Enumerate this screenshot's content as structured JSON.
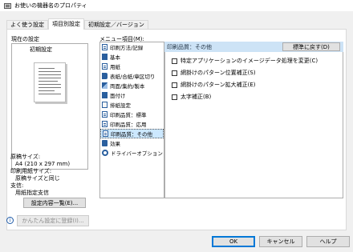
{
  "window": {
    "title": "お使いの機器名のプロパティ"
  },
  "tabs": [
    {
      "label": "よく使う設定"
    },
    {
      "label": "項目別設定"
    },
    {
      "label": "初期設定／バージョン"
    }
  ],
  "preview": {
    "heading": "現在の設定",
    "subheading": "初期設定",
    "info_lines": [
      "原稿サイズ:",
      "A4 (210 x 297 mm)",
      "印刷用紙サイズ:",
      "原稿サイズと同じ",
      "支信:",
      "用紙指定支信"
    ],
    "list_button": "設定内容一覧(E)...",
    "register_button": "かんたん設定に登録(I)..."
  },
  "menu": {
    "label": "メニュー項目(M):",
    "items": [
      {
        "label": "印刷方法/記録",
        "icon": "print-method-icon"
      },
      {
        "label": "基本",
        "icon": "basic-icon"
      },
      {
        "label": "用紙",
        "icon": "paper-icon"
      },
      {
        "label": "表紙/合紙/章区切り",
        "icon": "cover-icon"
      },
      {
        "label": "両面/集約/製本",
        "icon": "duplex-icon"
      },
      {
        "label": "面付け",
        "icon": "imposition-icon"
      },
      {
        "label": "排紙設定",
        "icon": "output-icon"
      },
      {
        "label": "印刷品質：標準",
        "icon": "quality-standard-icon"
      },
      {
        "label": "印刷品質：応用",
        "icon": "quality-advanced-icon"
      },
      {
        "label": "印刷品質：その他",
        "icon": "quality-other-icon"
      },
      {
        "label": "効果",
        "icon": "effect-icon"
      },
      {
        "label": "ドライバーオプション",
        "icon": "gear-icon"
      }
    ],
    "selected_index": 9
  },
  "pane": {
    "title": "印刷品質：その他",
    "restore_button": "標準に戻す(D)",
    "options": [
      {
        "label": "特定アプリケーションのイメージデータ処理を変更(C)",
        "checked": false
      },
      {
        "label": "網掛けのパターン位置補正(S)",
        "checked": false
      },
      {
        "label": "網掛けのパターン拡大補正(E)",
        "checked": false
      },
      {
        "label": "太字補正(B)",
        "checked": false
      }
    ]
  },
  "footer": {
    "ok": "OK",
    "cancel": "キャンセル",
    "help": "ヘルプ"
  },
  "colors": {
    "accent": "#0078d7",
    "selection": "#cce8ff",
    "pane_header": "#cde3f6",
    "icon_blue": "#2a5f9e"
  }
}
